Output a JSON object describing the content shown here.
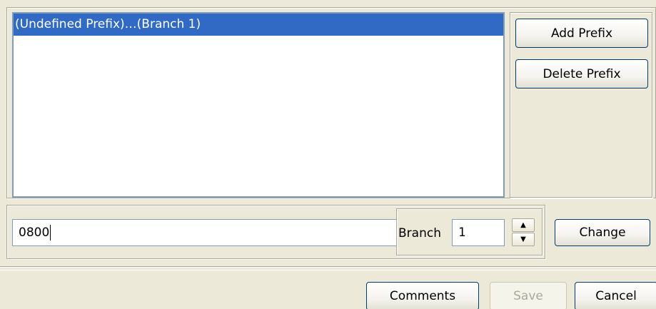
{
  "list": {
    "items": [
      {
        "label": "(Undefined Prefix)…(Branch 1)",
        "selected": true
      }
    ]
  },
  "side_buttons": {
    "add_label": "Add Prefix",
    "delete_label": "Delete Prefix"
  },
  "edit": {
    "prefix_value": "0800",
    "branch_label": "Branch",
    "branch_value": "1",
    "change_label": "Change"
  },
  "footer": {
    "comments_label": "Comments",
    "save_label": "Save",
    "save_enabled": false,
    "cancel_label": "Cancel"
  },
  "icons": {
    "spin_up": "spin-up-arrow-icon",
    "spin_down": "spin-down-arrow-icon"
  },
  "colors": {
    "selection": "#316ac5",
    "window_bg": "#ece9d8",
    "border": "#7f9db9"
  }
}
